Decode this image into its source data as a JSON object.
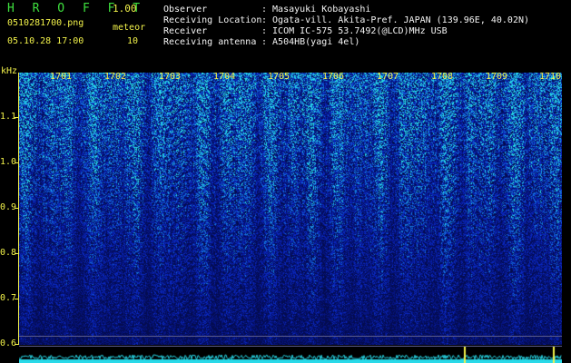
{
  "header": {
    "app_title": "H R O F F T",
    "version": "1.00",
    "file_name": "0510281700.png",
    "mode_label": "meteor",
    "date_time": "05.10.28 17:00",
    "meteor_count": "10"
  },
  "station_info": [
    {
      "label": "Observer",
      "value": ": Masayuki Kobayashi"
    },
    {
      "label": "Receiving Location",
      "value": ": Ogata-vill. Akita-Pref. JAPAN (139.96E, 40.02N)"
    },
    {
      "label": "Receiver",
      "value": ": ICOM IC-575 53.7492(@LCD)MHz USB"
    },
    {
      "label": "Receiving antenna",
      "value": ": A504HB(yagi 4el)"
    }
  ],
  "axis": {
    "unit": "kHz",
    "freq_labels": [
      "1.1",
      "1.0",
      "0.9",
      "0.8",
      "0.7",
      "0.6"
    ],
    "freq_range_khz": [
      0.58,
      1.17
    ],
    "minute_labels": [
      "1701",
      "1702",
      "1703",
      "1704",
      "1705",
      "1706",
      "1707",
      "1708",
      "1709",
      "1710"
    ]
  },
  "colors": {
    "background": "#000000",
    "title": "#3ee03e",
    "axis": "#f2f24a",
    "spectrogram_base": "#020a4a",
    "signal": "#29d9e8"
  }
}
